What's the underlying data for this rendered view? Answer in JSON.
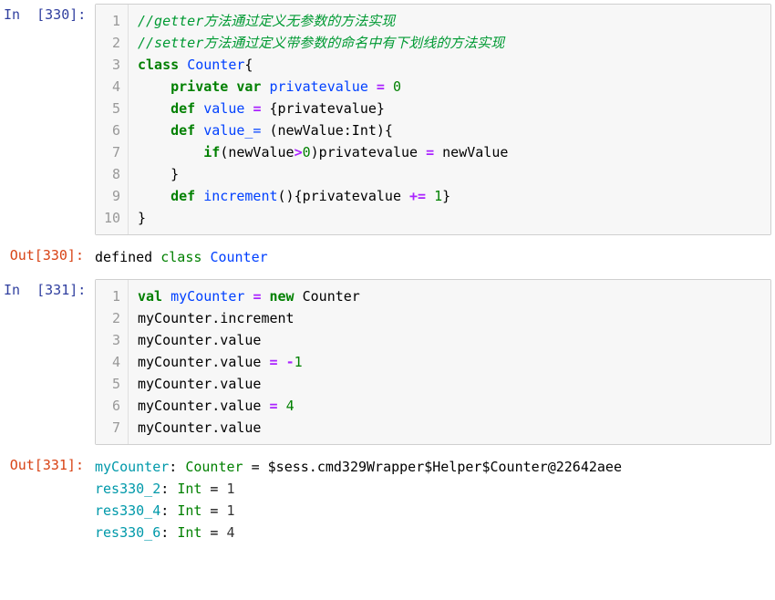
{
  "cells": [
    {
      "promptIn": "In  [330]:",
      "lines": [
        [
          {
            "t": "//getter方法通过定义无参数的方法实现",
            "c": "cm-comment"
          }
        ],
        [
          {
            "t": "//setter方法通过定义带参数的命名中有下划线的方法实现",
            "c": "cm-comment"
          }
        ],
        [
          {
            "t": "class",
            "c": "cm-keyword"
          },
          {
            "t": " "
          },
          {
            "t": "Counter",
            "c": "cm-def"
          },
          {
            "t": "{"
          }
        ],
        [
          {
            "t": "    "
          },
          {
            "t": "private",
            "c": "cm-keyword"
          },
          {
            "t": " "
          },
          {
            "t": "var",
            "c": "cm-keyword"
          },
          {
            "t": " "
          },
          {
            "t": "privatevalue",
            "c": "cm-def"
          },
          {
            "t": " "
          },
          {
            "t": "=",
            "c": "cm-operator"
          },
          {
            "t": " "
          },
          {
            "t": "0",
            "c": "cm-number"
          }
        ],
        [
          {
            "t": "    "
          },
          {
            "t": "def",
            "c": "cm-keyword"
          },
          {
            "t": " "
          },
          {
            "t": "value",
            "c": "cm-def"
          },
          {
            "t": " "
          },
          {
            "t": "=",
            "c": "cm-operator"
          },
          {
            "t": " {privatevalue}"
          }
        ],
        [
          {
            "t": "    "
          },
          {
            "t": "def",
            "c": "cm-keyword"
          },
          {
            "t": " "
          },
          {
            "t": "value_=",
            "c": "cm-def"
          },
          {
            "t": " (newValue:Int){"
          }
        ],
        [
          {
            "t": "        "
          },
          {
            "t": "if",
            "c": "cm-keyword"
          },
          {
            "t": "(newValue"
          },
          {
            "t": ">",
            "c": "cm-operator"
          },
          {
            "t": "0",
            "c": "cm-number"
          },
          {
            "t": ")privatevalue "
          },
          {
            "t": "=",
            "c": "cm-operator"
          },
          {
            "t": " newValue"
          }
        ],
        [
          {
            "t": "    }"
          }
        ],
        [
          {
            "t": "    "
          },
          {
            "t": "def",
            "c": "cm-keyword"
          },
          {
            "t": " "
          },
          {
            "t": "increment",
            "c": "cm-def"
          },
          {
            "t": "(){privatevalue "
          },
          {
            "t": "+=",
            "c": "cm-operator"
          },
          {
            "t": " "
          },
          {
            "t": "1",
            "c": "cm-number"
          },
          {
            "t": "}"
          }
        ],
        [
          {
            "t": "}"
          }
        ]
      ],
      "promptOut": "Out[330]:",
      "output": [
        [
          {
            "t": "defined "
          },
          {
            "t": "class",
            "c": "out-type"
          },
          {
            "t": " "
          },
          {
            "t": "Counter",
            "c": "cm-def"
          }
        ]
      ]
    },
    {
      "promptIn": "In  [331]:",
      "lines": [
        [
          {
            "t": "val",
            "c": "cm-keyword"
          },
          {
            "t": " "
          },
          {
            "t": "myCounter",
            "c": "cm-def"
          },
          {
            "t": " "
          },
          {
            "t": "=",
            "c": "cm-operator"
          },
          {
            "t": " "
          },
          {
            "t": "new",
            "c": "cm-keyword"
          },
          {
            "t": " Counter"
          }
        ],
        [
          {
            "t": "myCounter.increment"
          }
        ],
        [
          {
            "t": "myCounter.value"
          }
        ],
        [
          {
            "t": "myCounter.value "
          },
          {
            "t": "=",
            "c": "cm-operator"
          },
          {
            "t": " "
          },
          {
            "t": "-",
            "c": "cm-operator"
          },
          {
            "t": "1",
            "c": "cm-number"
          }
        ],
        [
          {
            "t": "myCounter.value"
          }
        ],
        [
          {
            "t": "myCounter.value "
          },
          {
            "t": "=",
            "c": "cm-operator"
          },
          {
            "t": " "
          },
          {
            "t": "4",
            "c": "cm-number"
          }
        ],
        [
          {
            "t": "myCounter.value"
          }
        ]
      ],
      "promptOut": "Out[331]:",
      "output": [
        [
          {
            "t": "myCounter",
            "c": "out-name"
          },
          {
            "t": ": "
          },
          {
            "t": "Counter",
            "c": "out-type"
          },
          {
            "t": " = $sess.cmd329Wrapper$Helper$Counter@22642aee"
          }
        ],
        [
          {
            "t": "res330_2",
            "c": "out-name"
          },
          {
            "t": ": "
          },
          {
            "t": "Int",
            "c": "out-type"
          },
          {
            "t": " = "
          },
          {
            "t": "1",
            "c": "out-val"
          }
        ],
        [
          {
            "t": "res330_4",
            "c": "out-name"
          },
          {
            "t": ": "
          },
          {
            "t": "Int",
            "c": "out-type"
          },
          {
            "t": " = "
          },
          {
            "t": "1",
            "c": "out-val"
          }
        ],
        [
          {
            "t": "res330_6",
            "c": "out-name"
          },
          {
            "t": ": "
          },
          {
            "t": "Int",
            "c": "out-type"
          },
          {
            "t": " = "
          },
          {
            "t": "4",
            "c": "out-val"
          }
        ]
      ]
    }
  ]
}
